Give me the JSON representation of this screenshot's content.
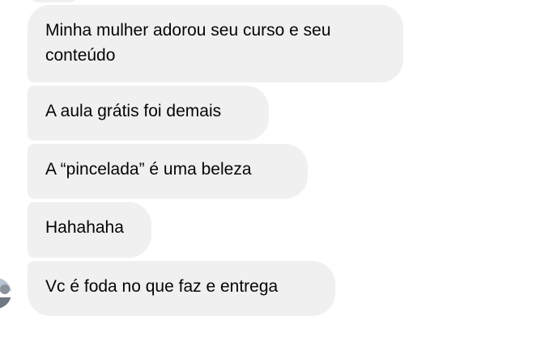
{
  "messages": [
    {
      "text": "Minha mulher adorou seu curso e seu conteúdo"
    },
    {
      "text": "A aula grátis foi demais"
    },
    {
      "text": "A “pincelada” é uma beleza"
    },
    {
      "text": "Hahahaha"
    },
    {
      "text": "Vc é foda no que faz e entrega"
    }
  ],
  "colors": {
    "bubble_background": "#f0f0f0",
    "text": "#050505",
    "page_background": "#ffffff"
  },
  "avatar": {
    "icon": "sender-avatar-icon"
  }
}
